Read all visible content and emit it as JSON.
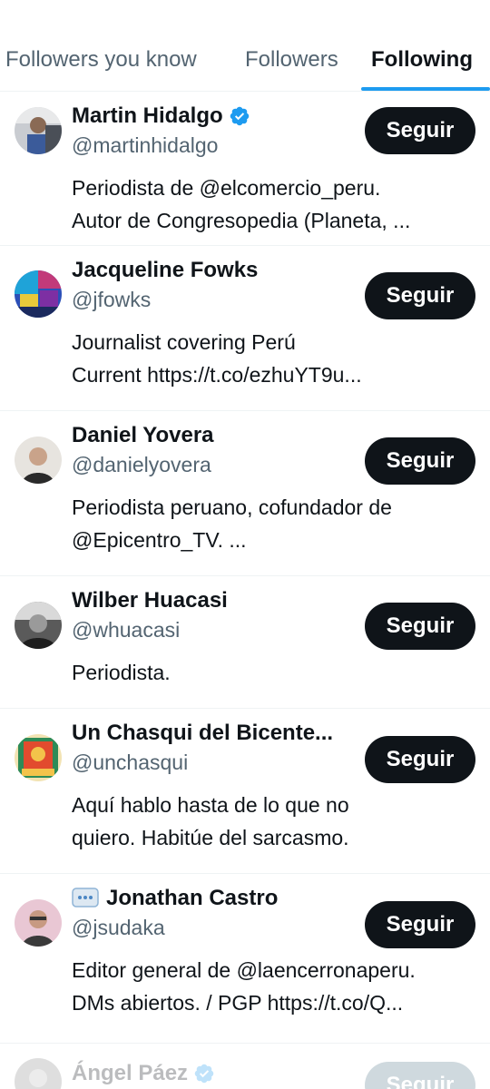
{
  "tabs": [
    {
      "label": "Followers you know",
      "active": false
    },
    {
      "label": "Followers",
      "active": false
    },
    {
      "label": "Following",
      "active": true
    }
  ],
  "follow_label": "Seguir",
  "accounts": [
    {
      "name": "Martin Hidalgo",
      "verified": true,
      "handle": "@martinhidalgo",
      "bio": "Periodista de @elcomercio_peru.\nAutor de Congresopedia (Planeta, ..."
    },
    {
      "name": "Jacqueline Fowks",
      "verified": false,
      "handle": "@jfowks",
      "bio": "Journalist covering Perú\nCurrent https://t.co/ezhuYT9u..."
    },
    {
      "name": "Daniel Yovera",
      "verified": false,
      "handle": "@danielyovera",
      "bio": "Periodista peruano, cofundador de\n@Epicentro_TV. ..."
    },
    {
      "name": "Wilber Huacasi",
      "verified": false,
      "handle": "@whuacasi",
      "bio": "Periodista."
    },
    {
      "name": "Un Chasqui del Bicente...",
      "verified": false,
      "handle": "@unchasqui",
      "bio": "Aquí hablo hasta de lo que no\nquiero. Habitúe del sarcasmo."
    },
    {
      "name": "Jonathan Castro",
      "verified": false,
      "name_emoji": "speech-bubble-emoji",
      "handle": "@jsudaka",
      "bio": "Editor general de @laencerronaperu.\nDMs abiertos. / PGP https://t.co/Q..."
    },
    {
      "name": "Ángel Páez",
      "verified": true,
      "handle": "",
      "bio": ""
    }
  ],
  "colors": {
    "accent": "#1d9bf0",
    "text_primary": "#0f1419",
    "text_secondary": "#536471",
    "button_bg": "#0f1419",
    "divider": "#eff3f4"
  }
}
